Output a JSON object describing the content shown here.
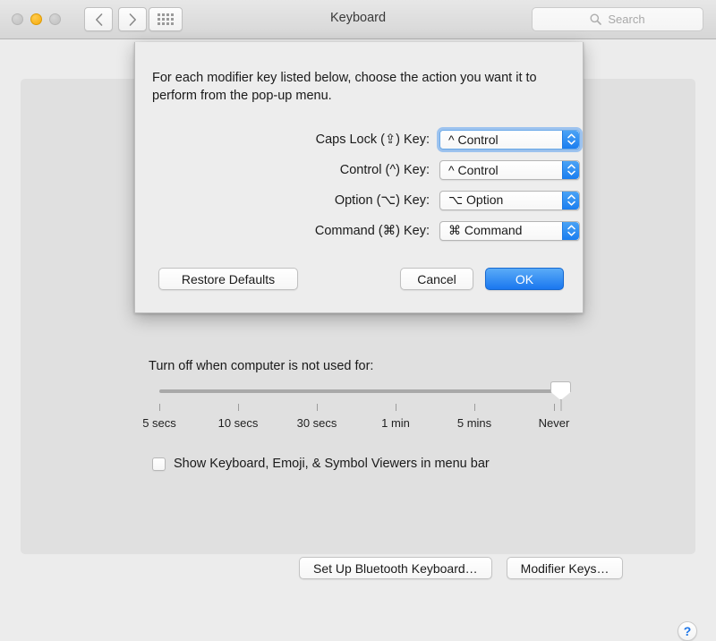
{
  "window": {
    "title": "Keyboard",
    "traffic_lights": [
      "close",
      "minimize",
      "maximize"
    ],
    "nav_back_icon": "chevron-left-icon",
    "nav_forward_icon": "chevron-right-icon",
    "grid_icon": "show-all-grid-icon",
    "search": {
      "icon": "search-icon",
      "placeholder": "Search",
      "value": ""
    }
  },
  "sheet": {
    "description": "For each modifier key listed below, choose the action you want it to perform from the pop-up menu.",
    "rows": [
      {
        "label": "Caps Lock (⇪) Key:",
        "value": "^ Control",
        "focused": true
      },
      {
        "label": "Control (^) Key:",
        "value": "^ Control",
        "focused": false
      },
      {
        "label": "Option (⌥) Key:",
        "value": "⌥ Option",
        "focused": false
      },
      {
        "label": "Command (⌘) Key:",
        "value": "⌘ Command",
        "focused": false
      }
    ],
    "buttons": {
      "restore": "Restore Defaults",
      "cancel": "Cancel",
      "ok": "OK"
    },
    "accent_color": "#1a77ef"
  },
  "background": {
    "slider_label": "Turn off when computer is not used for:",
    "slider_ticks": [
      "5 secs",
      "10 secs",
      "30 secs",
      "1 min",
      "5 mins",
      "Never"
    ],
    "slider_value": "Never",
    "checkbox_label": "Show Keyboard, Emoji, & Symbol Viewers in menu bar",
    "checkbox_checked": false,
    "bluetooth_button": "Set Up Bluetooth Keyboard…",
    "modifier_button": "Modifier Keys…",
    "help_label": "?"
  }
}
